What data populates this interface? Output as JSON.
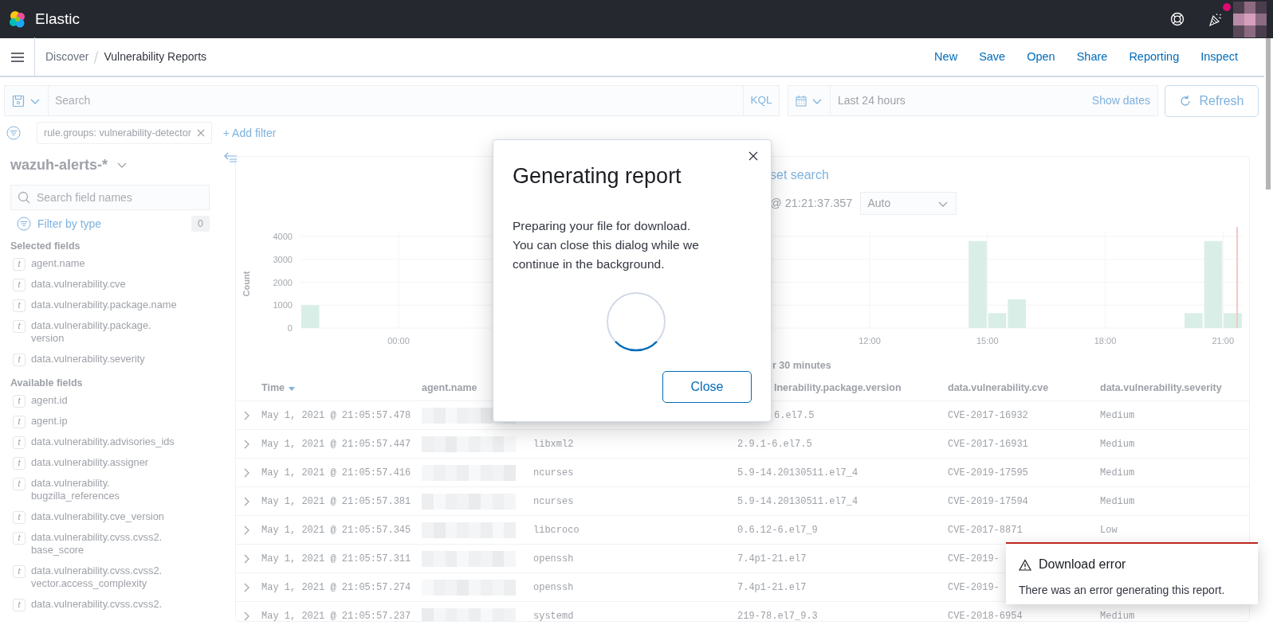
{
  "header": {
    "brand": "Elastic",
    "news_unread": true
  },
  "breadcrumbs": [
    "Discover",
    "Vulnerability Reports"
  ],
  "top_nav": [
    "New",
    "Save",
    "Open",
    "Share",
    "Reporting",
    "Inspect"
  ],
  "query_bar": {
    "placeholder": "Search",
    "language": "KQL",
    "date_range": "Last 24 hours",
    "show_dates": "Show dates",
    "refresh": "Refresh"
  },
  "filters": [
    {
      "label": "rule.groups: vulnerability-detector"
    }
  ],
  "add_filter": "+ Add filter",
  "sidebar": {
    "index_pattern": "wazuh-alerts-*",
    "search_placeholder": "Search field names",
    "filter_by_type": "Filter by type",
    "filter_count": "0",
    "sections": [
      {
        "title": "Selected fields",
        "fields": [
          {
            "type": "t",
            "name": "agent.name"
          },
          {
            "type": "t",
            "name": "data.vulnerability.cve"
          },
          {
            "type": "t",
            "name": "data.vulnerability.package.name"
          },
          {
            "type": "t",
            "name": "data.vulnerability.package.version"
          },
          {
            "type": "t",
            "name": "data.vulnerability.severity"
          }
        ]
      },
      {
        "title": "Available fields",
        "fields": [
          {
            "type": "t",
            "name": "agent.id"
          },
          {
            "type": "t",
            "name": "agent.ip"
          },
          {
            "type": "t",
            "name": "data.vulnerability.advisories_ids"
          },
          {
            "type": "t",
            "name": "data.vulnerability.assigner"
          },
          {
            "type": "t",
            "name": "data.vulnerability.bugzilla_references"
          },
          {
            "type": "t",
            "name": "data.vulnerability.cve_version"
          },
          {
            "type": "t",
            "name": "data.vulnerability.cvss.cvss2.base_score"
          },
          {
            "type": "t",
            "name": "data.vulnerability.cvss.cvss2.vector.access_complexity"
          },
          {
            "type": "t",
            "name": "data.vulnerability.cvss.cvss2."
          }
        ]
      }
    ]
  },
  "results": {
    "reset_search": "set search",
    "time_range": "@ 21:21:37.357",
    "interval": "Auto",
    "interval_note": "r 30 minutes",
    "chart_data": {
      "type": "bar",
      "ylabel": "Count",
      "x": [
        -2.25,
        14.75,
        15.25,
        15.75,
        20.25,
        20.75,
        21.25
      ],
      "series": [
        {
          "color": "#d9eee7",
          "values": [
            1000,
            3800,
            650,
            1250,
            650,
            3800,
            650
          ]
        }
      ],
      "xlim": [
        -2.5,
        21.5
      ],
      "ylim": [
        0,
        4200
      ],
      "grid": true,
      "xticks": [
        {
          "value": 0,
          "label": "00:00"
        },
        {
          "value": 12,
          "label": "12:00"
        },
        {
          "value": 15,
          "label": "15:00"
        },
        {
          "value": 18,
          "label": "18:00"
        },
        {
          "value": 21,
          "label": "21:00"
        }
      ],
      "yticks": [
        0,
        1000,
        2000,
        3000,
        4000
      ]
    },
    "columns": {
      "time": {
        "label": "Time",
        "sorted": true
      },
      "agent_name": {
        "label": "agent.name"
      },
      "column_4": {
        "label": "lnerability.package.version"
      },
      "cve": {
        "label": "data.vulnerability.cve"
      },
      "severity": {
        "label": "data.vulnerability.severity"
      }
    },
    "rows": [
      {
        "time": "May 1, 2021 @ 21:05:57.478",
        "column_4": "6.el7.5",
        "cve": "CVE-2017-16932",
        "severity": "Medium"
      },
      {
        "time": "May 1, 2021 @ 21:05:57.447",
        "column_3": "libxml2",
        "column_4": "2.9.1-6.el7.5",
        "cve": "CVE-2017-16931",
        "severity": "Medium"
      },
      {
        "time": "May 1, 2021 @ 21:05:57.416",
        "column_3": "ncurses",
        "column_4": "5.9-14.20130511.el7_4",
        "cve": "CVE-2019-17595",
        "severity": "Medium"
      },
      {
        "time": "May 1, 2021 @ 21:05:57.381",
        "column_3": "ncurses",
        "column_4": "5.9-14.20130511.el7_4",
        "cve": "CVE-2019-17594",
        "severity": "Medium"
      },
      {
        "time": "May 1, 2021 @ 21:05:57.345",
        "column_3": "libcroco",
        "column_4": "0.6.12-6.el7_9",
        "cve": "CVE-2017-8871",
        "severity": "Low"
      },
      {
        "time": "May 1, 2021 @ 21:05:57.311",
        "column_3": "openssh",
        "column_4": "7.4p1-21.el7",
        "cve": "CVE-2019-"
      },
      {
        "time": "May 1, 2021 @ 21:05:57.274",
        "column_3": "openssh",
        "column_4": "7.4p1-21.el7",
        "cve": "CVE-2019-"
      },
      {
        "time": "May 1, 2021 @ 21:05:57.237",
        "column_3": "systemd",
        "column_4": "219-78.el7_9.3",
        "cve": "CVE-2018-6954",
        "severity": "Medium"
      }
    ]
  },
  "modal": {
    "title": "Generating report",
    "body": "Preparing your file for download. You can close this dialog while we continue in the background.",
    "button": "Close"
  },
  "toast": {
    "title": "Download error",
    "body": "There was an error generating this report."
  }
}
